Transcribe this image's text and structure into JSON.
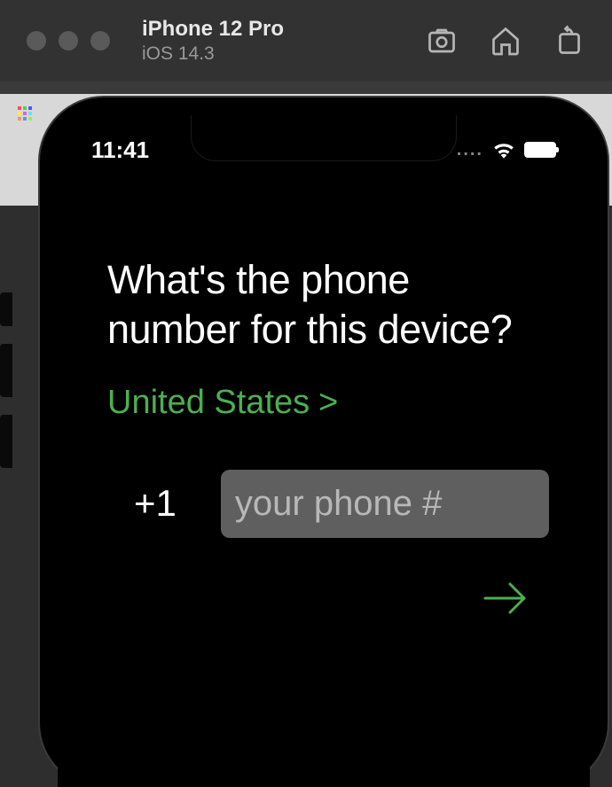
{
  "simulator": {
    "device_name": "iPhone 12 Pro",
    "device_os": "iOS 14.3"
  },
  "status": {
    "time": "11:41",
    "cellular": "....",
    "wifi": true,
    "battery_full": true
  },
  "form": {
    "heading": "What's the phone number for this device?",
    "country_label": "United States",
    "country_chevron": ">",
    "dial_code": "+1",
    "phone_placeholder": "your phone #",
    "phone_value": ""
  },
  "icons": {
    "screenshot": "screenshot-icon",
    "home": "home-icon",
    "rotate": "rotate-icon",
    "wifi": "wifi-icon",
    "arrow": "arrow-right-icon"
  }
}
